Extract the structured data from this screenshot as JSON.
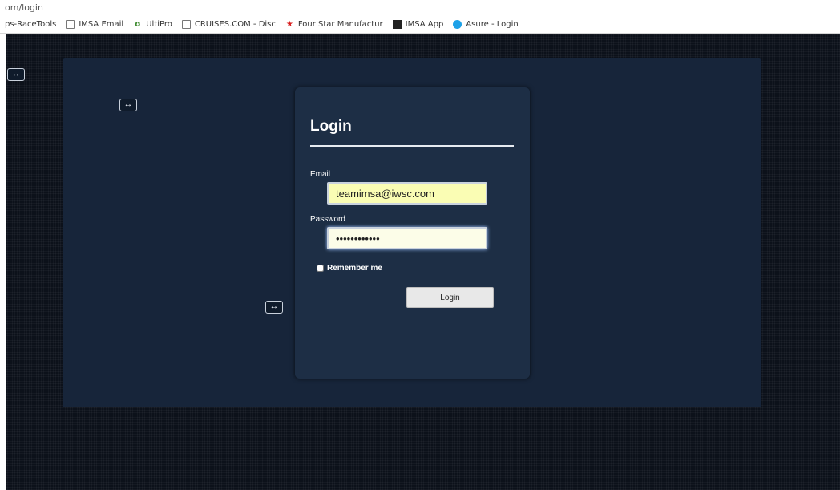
{
  "address_bar": {
    "url_fragment": "om/login"
  },
  "bookmarks": [
    {
      "label": "ps-RaceTools",
      "icon": "none"
    },
    {
      "label": "IMSA Email",
      "icon": "page-icon"
    },
    {
      "label": "UltiPro",
      "icon": "ultipro-icon"
    },
    {
      "label": "CRUISES.COM - Disc",
      "icon": "page-icon"
    },
    {
      "label": "Four Star Manufactur",
      "icon": "star-icon"
    },
    {
      "label": "IMSA App",
      "icon": "imsa-app-icon"
    },
    {
      "label": "Asure - Login",
      "icon": "asure-icon"
    }
  ],
  "collapse_buttons": {
    "glyph": "↔"
  },
  "login_form": {
    "title": "Login",
    "email_label": "Email",
    "email_value": "teamimsa@iwsc.com",
    "password_label": "Password",
    "password_value": "••••••••••••",
    "remember_label": "Remember me",
    "remember_checked": false,
    "submit_label": "Login"
  },
  "colors": {
    "page_background": "#0c111a",
    "stage_background": "#17253a",
    "card_background": "#1d2e45",
    "email_field_background": "#fafdb4",
    "button_background": "#e8e8e8"
  }
}
